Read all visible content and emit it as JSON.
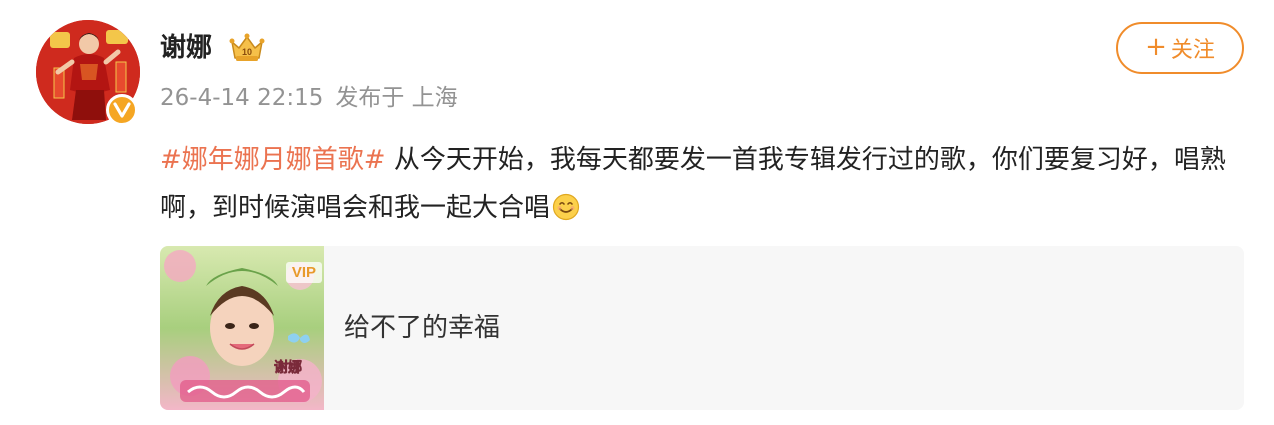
{
  "post": {
    "author": {
      "name": "谢娜",
      "avatar_icon": "user-avatar",
      "verified_icon": "verified-v-badge",
      "member_icon": "vip-crown-icon"
    },
    "timestamp": "26-4-14 22:15",
    "published_from": "发布于 上海",
    "follow_label": "关注",
    "content": {
      "hashtag": "#娜年娜月娜首歌#",
      "text": " 从今天开始，我每天都要发一首我专辑发行过的歌，你们要复习好，唱熟啊，到时候演唱会和我一起大合唱",
      "emoji": "smile-emoji"
    },
    "music_card": {
      "cover_badge": "VIP",
      "cover_text": "谢娜",
      "title": "给不了的幸福"
    }
  },
  "colors": {
    "accent_orange": "#f08c2b",
    "hashtag": "#eb7350",
    "meta_gray": "#939393",
    "card_bg": "#f7f7f7"
  }
}
